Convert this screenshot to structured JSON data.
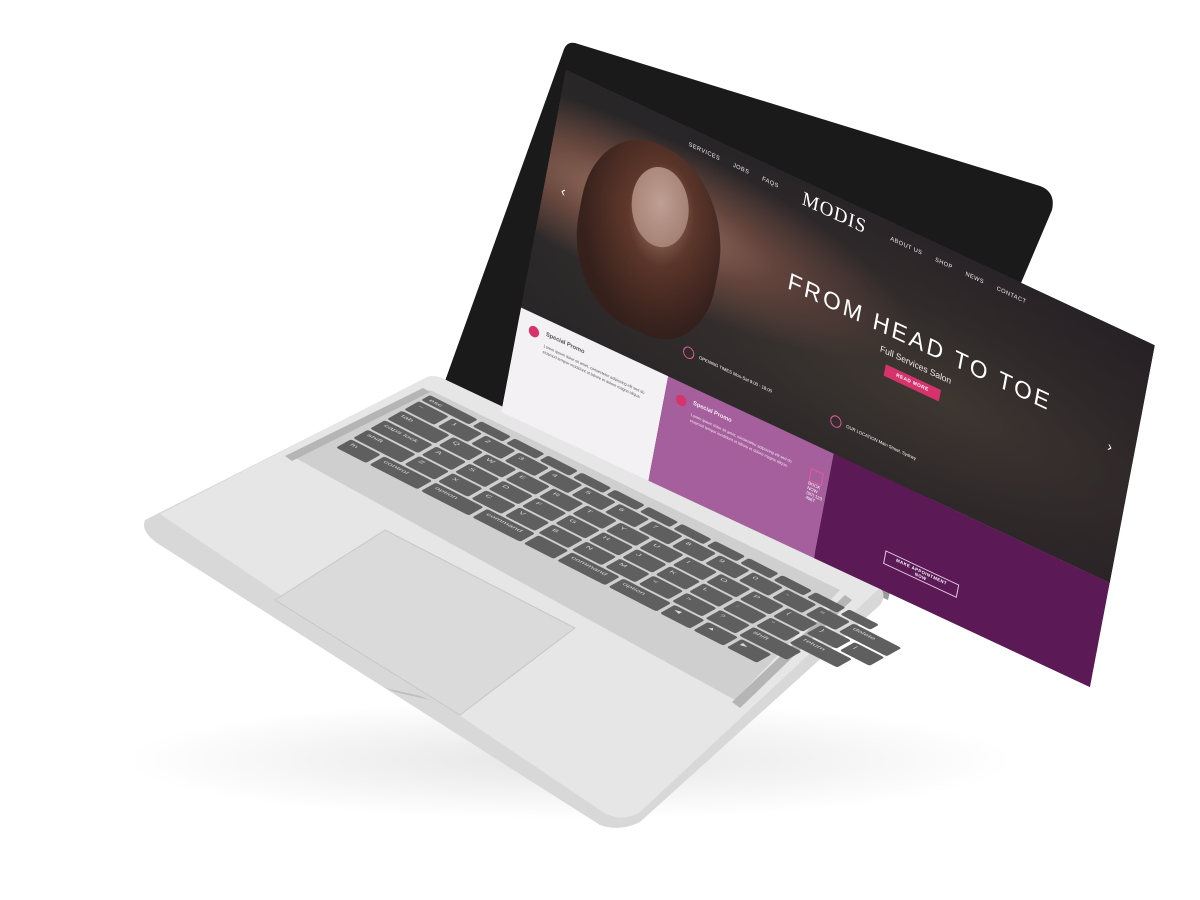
{
  "site": {
    "nav": {
      "left": [
        "SERVICES",
        "JOBS",
        "FAQS"
      ],
      "logo": "MODIS",
      "right": [
        "ABOUT US",
        "SHOP",
        "NEWS",
        "CONTACT"
      ]
    },
    "hero": {
      "title": "FROM HEAD TO TOE",
      "subtitle": "Full Services Salon",
      "cta_label": "READ MORE"
    },
    "cards": {
      "special_promo_left": {
        "title": "Special Promo",
        "text": "Lorem ipsum dolor sit amet, consectetur adipiscing elit sed do eiusmod tempor incididunt ut labore et dolore magna aliqua."
      },
      "opening_hours": {
        "title": "OPENING TIMES",
        "text": "Mon-Sat 9:00 - 18:00"
      },
      "location": {
        "title": "OUR LOCATION",
        "text": "Main Street, Sydney"
      },
      "special_promo_mid": {
        "title": "Special Promo",
        "text": "Lorem ipsum dolor sit amet, consectetur adipiscing elit sed do eiusmod tempor incididunt ut labore et dolore magna aliqua."
      },
      "book": {
        "title": "BOOK NOW",
        "text": "(00) 123 4567"
      },
      "appointment_label": "MAKE APPOINTMENT NOW"
    },
    "colors": {
      "accent": "#d6336c",
      "purple_dark": "#5b1a56",
      "purple_mid": "#a55f9c"
    }
  },
  "keyboard": {
    "rows": [
      [
        "esc",
        "",
        "",
        "",
        "",
        "",
        "",
        "",
        "",
        "",
        "",
        "",
        ""
      ],
      [
        "~",
        "1",
        "2",
        "3",
        "4",
        "5",
        "6",
        "7",
        "8",
        "9",
        "0",
        "-",
        "=",
        "delete"
      ],
      [
        "tab",
        "Q",
        "W",
        "E",
        "R",
        "T",
        "Y",
        "U",
        "I",
        "O",
        "P",
        "{",
        "}",
        "|"
      ],
      [
        "caps lock",
        "A",
        "S",
        "D",
        "F",
        "G",
        "H",
        "J",
        "K",
        "L",
        ":",
        "\"",
        "return"
      ],
      [
        "shift",
        "Z",
        "X",
        "C",
        "V",
        "B",
        "N",
        "M",
        "<",
        ">",
        "?",
        "shift"
      ],
      [
        "fn",
        "control",
        "option",
        "command",
        "",
        "command",
        "option",
        "◀",
        "▲",
        "▶"
      ]
    ]
  }
}
